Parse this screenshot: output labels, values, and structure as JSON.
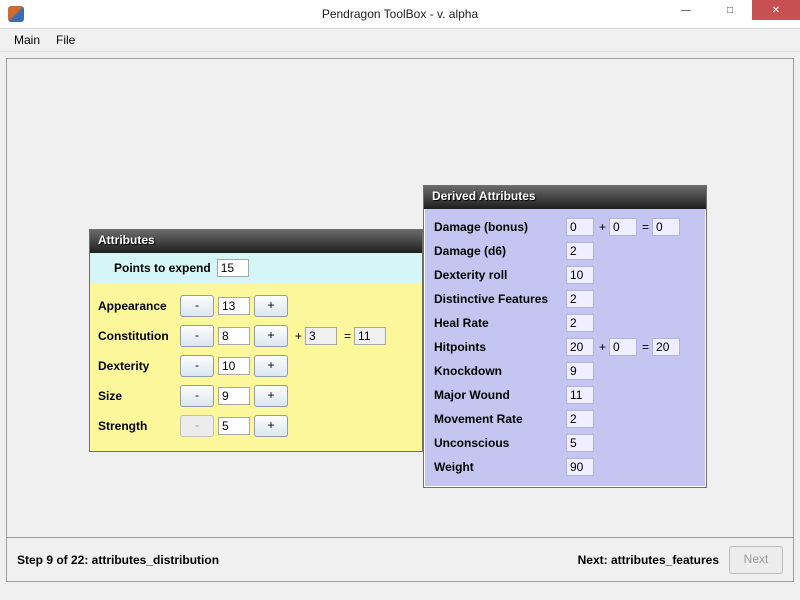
{
  "window": {
    "title": "Pendragon ToolBox - v. alpha",
    "min_glyph": "—",
    "max_glyph": "□",
    "close_glyph": "✕"
  },
  "menu": {
    "main": "Main",
    "file": "File"
  },
  "attributes_panel": {
    "title": "Attributes",
    "points_label": "Points to expend",
    "points_value": "15",
    "rows": [
      {
        "name": "Appearance",
        "minus": "-",
        "value": "13",
        "plus": "+",
        "minus_enabled": true,
        "has_extra": false
      },
      {
        "name": "Constitution",
        "minus": "-",
        "value": "8",
        "plus": "+",
        "minus_enabled": true,
        "has_extra": true,
        "extra_plus_text": "+",
        "extra_value": "3",
        "eq": "=",
        "total": "11"
      },
      {
        "name": "Dexterity",
        "minus": "-",
        "value": "10",
        "plus": "+",
        "minus_enabled": true,
        "has_extra": false
      },
      {
        "name": "Size",
        "minus": "-",
        "value": "9",
        "plus": "+",
        "minus_enabled": true,
        "has_extra": false
      },
      {
        "name": "Strength",
        "minus": "-",
        "value": "5",
        "plus": "+",
        "minus_enabled": false,
        "has_extra": false
      }
    ]
  },
  "derived_panel": {
    "title": "Derived Attributes",
    "rows": [
      {
        "name": "Damage (bonus)",
        "a": "0",
        "op1": "+",
        "b": "0",
        "eq": "=",
        "c": "0"
      },
      {
        "name": "Damage (d6)",
        "a": "2"
      },
      {
        "name": "Dexterity roll",
        "a": "10"
      },
      {
        "name": "Distinctive Features",
        "a": "2"
      },
      {
        "name": "Heal Rate",
        "a": "2"
      },
      {
        "name": "Hitpoints",
        "a": "20",
        "op1": "+",
        "b": "0",
        "eq": "=",
        "c": "20"
      },
      {
        "name": "Knockdown",
        "a": "9"
      },
      {
        "name": "Major Wound",
        "a": "11"
      },
      {
        "name": "Movement Rate",
        "a": "2"
      },
      {
        "name": "Unconscious",
        "a": "5"
      },
      {
        "name": "Weight",
        "a": "90"
      }
    ]
  },
  "footer": {
    "step_text": "Step 9 of 22: attributes_distribution",
    "next_label": "Next: attributes_features",
    "next_button": "Next"
  }
}
